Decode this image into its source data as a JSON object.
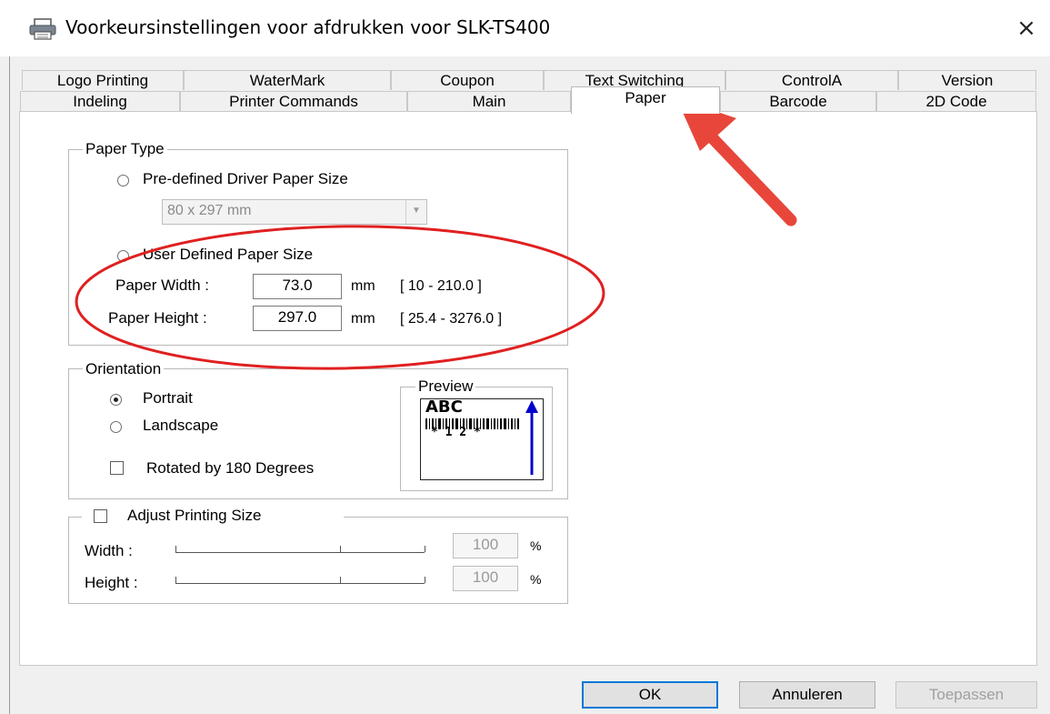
{
  "window": {
    "title": "Voorkeursinstellingen voor afdrukken voor SLK-TS400",
    "close_icon": "×"
  },
  "tabs_row1": [
    "Logo Printing",
    "WaterMark",
    "Coupon",
    "Text Switching",
    "ControlA",
    "Version"
  ],
  "tabs_row2": [
    "Indeling",
    "Printer Commands",
    "Main",
    "Paper",
    "Barcode",
    "2D Code"
  ],
  "active_tab": "Paper",
  "paper_type": {
    "title": "Paper Type",
    "predefined_label": "Pre-defined Driver Paper Size",
    "predefined_value": "80 x 297 mm",
    "user_defined_label": "User Defined Paper Size",
    "width_label": "Paper Width :",
    "width_value": "73.0",
    "width_unit": "mm",
    "width_range": "[ 10 - 210.0 ]",
    "height_label": "Paper Height :",
    "height_value": "297.0",
    "height_unit": "mm",
    "height_range": "[ 25.4 - 3276.0 ]"
  },
  "orientation": {
    "title": "Orientation",
    "portrait_label": "Portrait",
    "landscape_label": "Landscape",
    "rotated_label": "Rotated by 180 Degrees",
    "preview_title": "Preview",
    "preview_text_top": "ABC",
    "preview_text_bottom": "* 1 2 *"
  },
  "adjust": {
    "title": "Adjust Printing Size",
    "width_label": "Width :",
    "width_value": "100",
    "height_label": "Height :",
    "height_value": "100",
    "percent": "%"
  },
  "buttons": {
    "ok": "OK",
    "cancel": "Annuleren",
    "apply": "Toepassen"
  },
  "annotations": {
    "ellipse_color": "#e02020",
    "arrow_color": "#e8463a"
  }
}
